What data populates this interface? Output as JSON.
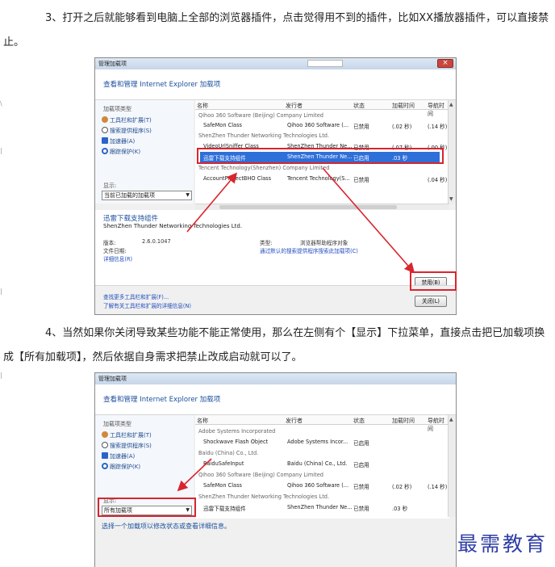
{
  "paragraphs": {
    "p1": "3、打开之后就能够看到电脑上全部的浏览器插件，点击觉得用不到的插件，比如XX播放器插件，可以直接禁止。",
    "p2": "4、当然如果你关闭导致某些功能不能正常使用，那么在左侧有个【显示】下拉菜单，直接点击把已加载项换成【所有加载项】，然后依据自身需求把禁止改成启动就可以了。"
  },
  "dialog": {
    "title": "管理加载项",
    "header": "查看和管理 Internet Explorer 加载项",
    "left": {
      "group_label": "加载项类型",
      "items": [
        "工具栏和扩展(T)",
        "搜索提供程序(S)",
        "加速器(A)",
        "跟踪保护(K)"
      ],
      "show_label": "显示:"
    },
    "columns": [
      "名称",
      "发行者",
      "状态",
      "加载时间",
      "导航时间"
    ]
  },
  "dialog1": {
    "select_value": "当前已加载的加载项",
    "rows": [
      {
        "group": "Qihoo 360 Software (Beijing) Company Limited"
      },
      {
        "name": "SafeMon Class",
        "publisher": "Qihoo 360 Software (...",
        "status": "已禁用",
        "load": "(.02 秒)",
        "nav": "(.14 秒)"
      },
      {
        "group": "ShenZhen Thunder Networking Technologies Ltd."
      },
      {
        "name": "VideoUrlSniffer Class",
        "publisher": "ShenZhen Thunder Ne...",
        "status": "已禁用",
        "load": "(.07 秒)",
        "nav": "(.00 秒)"
      },
      {
        "name": "迅雷下载支持组件",
        "publisher": "ShenZhen Thunder Ne...",
        "status": "已启用",
        "load": ".03 秒",
        "nav": "",
        "selected": true
      },
      {
        "group": "Tencent Technology(Shenzhen) Company Limited"
      },
      {
        "name": "AccountProtectBHO Class",
        "publisher": "Tencent Technology(S...",
        "status": "已禁用",
        "load": "",
        "nav": "(.04 秒)"
      }
    ],
    "detail": {
      "name": "迅雷下载支持组件",
      "publisher": "ShenZhen Thunder Networking Technologies Ltd.",
      "version_label": "版本:",
      "version": "2.6.0.1047",
      "date_label": "文件日期:",
      "more_info": "详细信息(R)",
      "type_label": "类型:",
      "type": "浏览器帮助程序对象",
      "search_link": "通过默认的搜索提供程序搜索此加载项(C)"
    },
    "footer": {
      "link1": "查找更多工具栏和扩展(F)...",
      "link2": "了解有关工具栏和扩展的详细信息(N)",
      "disable_btn": "禁用(B)",
      "close_btn": "关闭(L)"
    }
  },
  "dialog2": {
    "select_value": "所有加载项",
    "rows": [
      {
        "group": "Adobe Systems Incorporated"
      },
      {
        "name": "Shockwave Flash Object",
        "publisher": "Adobe Systems Incor...",
        "status": "已启用",
        "load": "",
        "nav": ""
      },
      {
        "group": "Baidu (China) Co., Ltd."
      },
      {
        "name": "BaiduSafeInput",
        "publisher": "Baidu (China) Co., Ltd.",
        "status": "已启用",
        "load": "",
        "nav": ""
      },
      {
        "group": "Qihoo 360 Software (Beijing) Company Limited"
      },
      {
        "name": "SafeMon Class",
        "publisher": "Qihoo 360 Software (...",
        "status": "已禁用",
        "load": "(.02 秒)",
        "nav": "(.14 秒)"
      },
      {
        "group": "ShenZhen Thunder Networking Technologies Ltd."
      },
      {
        "name": "迅雷下载支持组件",
        "publisher": "ShenZhen Thunder Ne...",
        "status": "已禁用",
        "load": ".03 秒",
        "nav": ""
      }
    ],
    "status_text": "选择一个加载项以修改状态或查看详细信息。"
  },
  "watermark": "最需教育",
  "colors": {
    "highlight_red": "#d9252e",
    "selection_blue": "#2f6fd8",
    "link_blue": "#1c4f9c",
    "watermark": "#2f3ea6"
  }
}
